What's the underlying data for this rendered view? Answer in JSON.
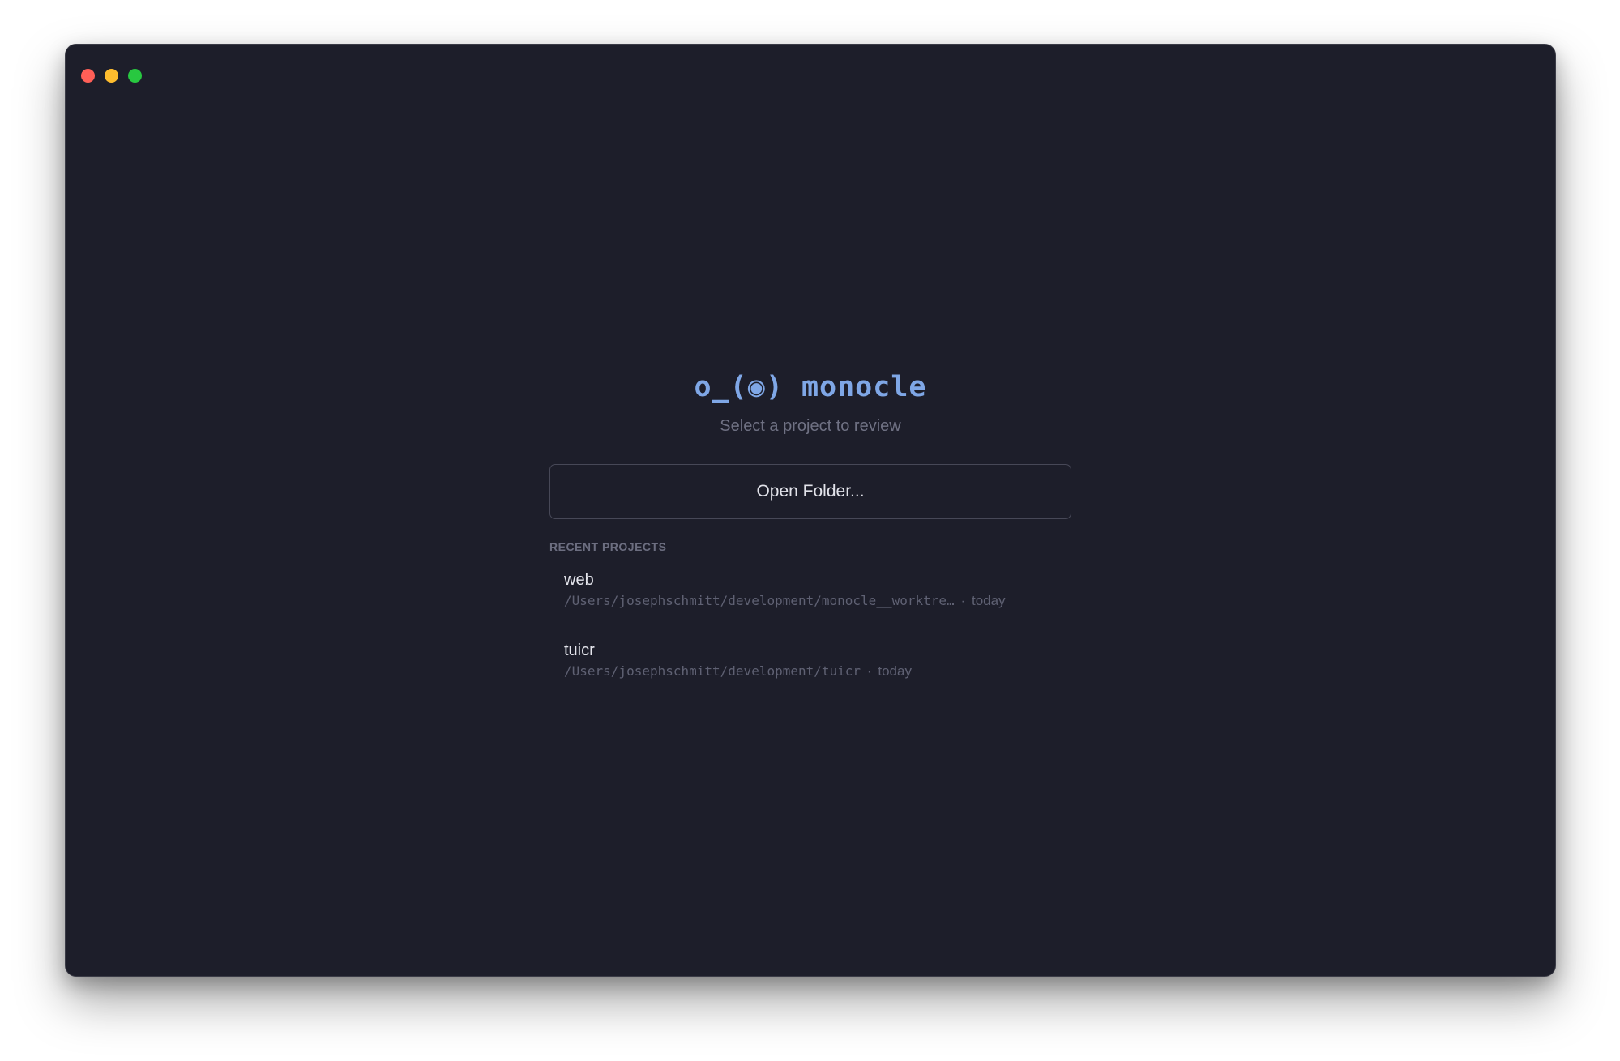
{
  "window": {
    "buttons": {
      "close_color": "#ff5f57",
      "minimize_color": "#febc2e",
      "zoom_color": "#28c840"
    }
  },
  "logo": {
    "text": "o_(◉) monocle",
    "color": "#7fa7e6"
  },
  "subtitle": "Select a project to review",
  "open_button": {
    "label": "Open Folder..."
  },
  "recent": {
    "heading": "RECENT PROJECTS",
    "items": [
      {
        "name": "web",
        "path": "/Users/josephschmitt/development/monocle__worktre…",
        "separator": "·",
        "when": "today"
      },
      {
        "name": "tuicr",
        "path": "/Users/josephschmitt/development/tuicr",
        "separator": "·",
        "when": "today"
      }
    ]
  }
}
